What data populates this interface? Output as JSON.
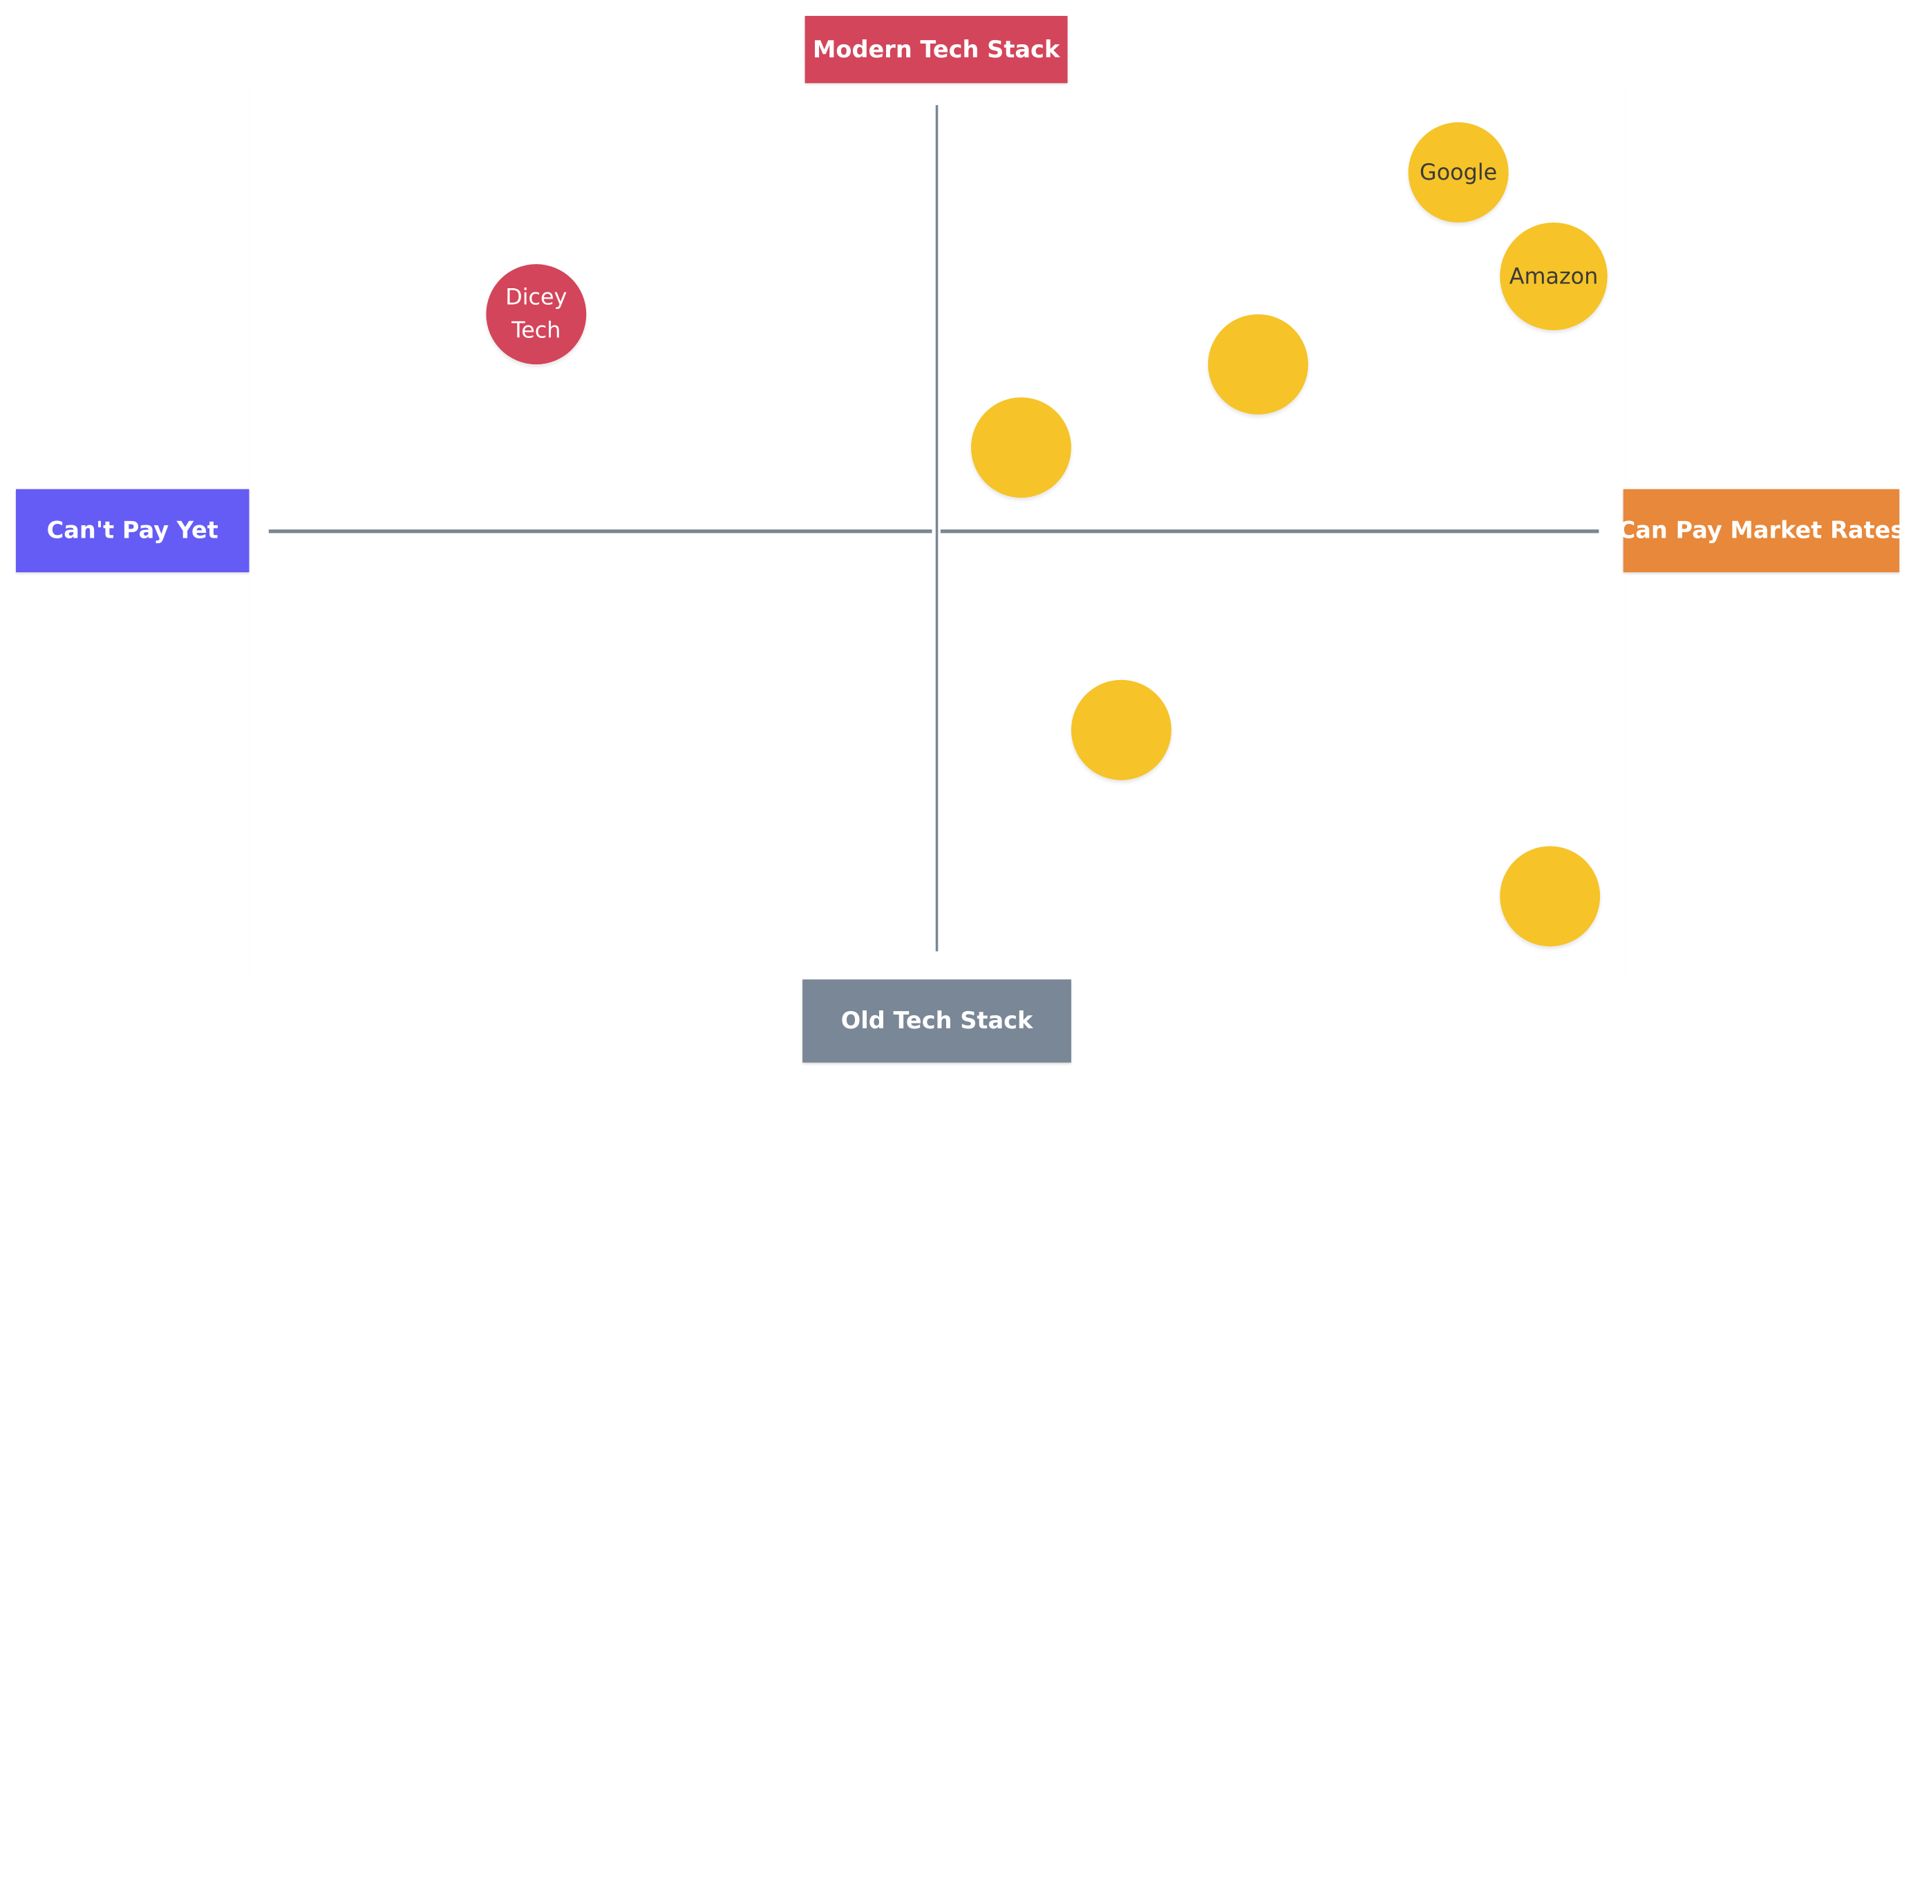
{
  "quadrant": {
    "top_label": "Modern Tech Stack",
    "bottom_label": "Old Tech Stack",
    "left_label": "Can't Pay Yet",
    "right_label": "Can Pay Market Rates",
    "colors": {
      "top": "#d3455a",
      "bottom": "#7a8796",
      "left": "#655cf6",
      "right": "#e8883a",
      "axis": "#7a8793",
      "yellow_dot": "#f6c328",
      "red_dot": "#d3455a"
    }
  },
  "items": [
    {
      "name": "Google",
      "color": "yellow"
    },
    {
      "name": "Amazon",
      "color": "yellow"
    },
    {
      "name": "Dicey Tech",
      "color": "red"
    },
    {
      "name": "",
      "color": "yellow"
    },
    {
      "name": "",
      "color": "yellow"
    },
    {
      "name": "",
      "color": "yellow"
    },
    {
      "name": "",
      "color": "yellow"
    }
  ]
}
